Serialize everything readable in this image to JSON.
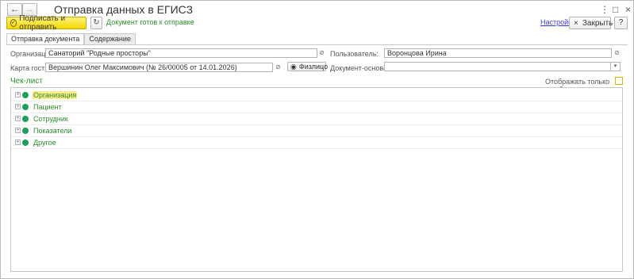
{
  "window": {
    "title": "Отправка данных в ЕГИСЗ",
    "nav_back": "←",
    "nav_forward": "→",
    "more_icon": "⋮",
    "maximize_icon": "□",
    "close_icon": "×"
  },
  "toolbar": {
    "primary_label": "Подписать и отправить",
    "refresh_icon": "↻",
    "status_text": "Документ готов к отправке",
    "settings_link": "Настройки",
    "close_label": "Закрыть",
    "close_icon": "×",
    "help_label": "?"
  },
  "tabs": [
    {
      "label": "Отправка документа",
      "active": true
    },
    {
      "label": "Содержание",
      "active": false
    }
  ],
  "form": {
    "organization_label": "Организация:",
    "organization_value": "Санаторий \"Родные просторы\"",
    "guest_card_label": "Карта гостя:",
    "guest_card_value": "Вершинин Олег Максимович (№ 26/00005 от 14.01.2026)",
    "physperson_button": "Физлицо",
    "user_label": "Пользователь:",
    "user_value": "Воронцова Ирина",
    "basis_doc_label": "Документ-основание:",
    "basis_doc_value": "",
    "link_icon": "⊘",
    "dropdown_icon": "▾"
  },
  "checklist": {
    "title": "Чек-лист",
    "only_errors_label": "Отображать только ошибки:",
    "only_errors_checked": false,
    "items": [
      {
        "label": "Организация",
        "selected": true
      },
      {
        "label": "Пациент",
        "selected": false
      },
      {
        "label": "Сотрудник",
        "selected": false
      },
      {
        "label": "Показатели",
        "selected": false
      },
      {
        "label": "Другое",
        "selected": false
      }
    ]
  },
  "colors": {
    "accent_yellow": "#f4d800",
    "status_green": "#2a8f2a",
    "dot_green": "#1aa05a",
    "link_blue": "#3a3ad6"
  }
}
